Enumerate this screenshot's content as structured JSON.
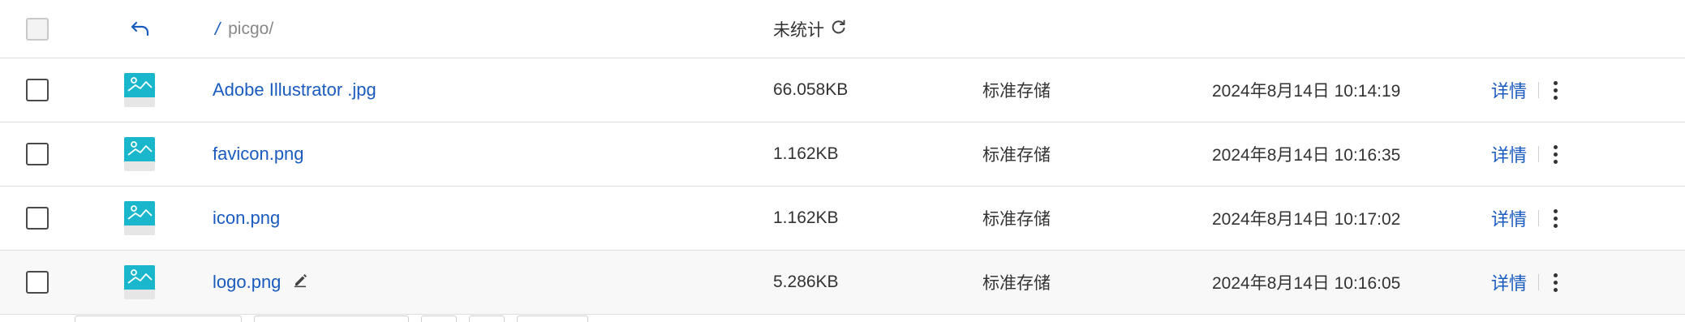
{
  "header": {
    "path_prefix": "/",
    "path": "picgo/",
    "stat_label": "未统计"
  },
  "files": [
    {
      "name": "Adobe Illustrator .jpg",
      "size": "66.058KB",
      "storage": "标准存储",
      "date": "2024年8月14日 10:14:19",
      "details": "详情"
    },
    {
      "name": "favicon.png",
      "size": "1.162KB",
      "storage": "标准存储",
      "date": "2024年8月14日 10:16:35",
      "details": "详情"
    },
    {
      "name": "icon.png",
      "size": "1.162KB",
      "storage": "标准存储",
      "date": "2024年8月14日 10:17:02",
      "details": "详情"
    },
    {
      "name": "logo.png",
      "size": "5.286KB",
      "storage": "标准存储",
      "date": "2024年8月14日 10:16:05",
      "details": "详情"
    }
  ],
  "icons": {
    "back": "back-arrow-icon",
    "refresh": "refresh-icon",
    "thumbnail": "image-thumbnail-icon",
    "more": "more-vertical-icon",
    "edit": "pencil-icon"
  },
  "colors": {
    "link": "#1a5bbf",
    "thumbnail": "#1ab7cc"
  }
}
